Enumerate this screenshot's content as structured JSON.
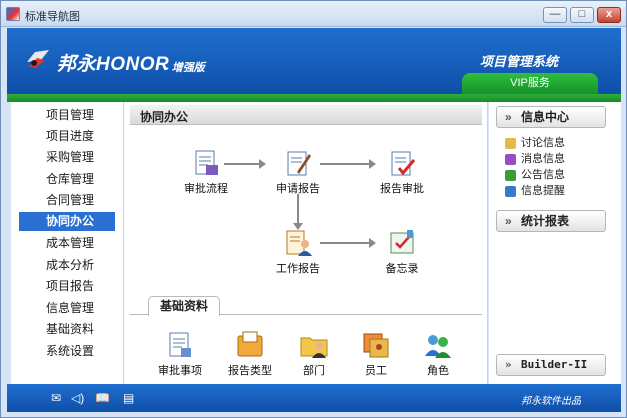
{
  "window": {
    "title": "标准导航图"
  },
  "header": {
    "brand": "邦永HONOR",
    "edition": "- 增强版",
    "system_title": "项目管理系统",
    "vip_tab": "VIP服务"
  },
  "nav": {
    "items": [
      {
        "label": "项目管理"
      },
      {
        "label": "项目进度"
      },
      {
        "label": "采购管理"
      },
      {
        "label": "仓库管理"
      },
      {
        "label": "合同管理"
      },
      {
        "label": "协同办公"
      },
      {
        "label": "成本管理"
      },
      {
        "label": "成本分析"
      },
      {
        "label": "项目报告"
      },
      {
        "label": "信息管理"
      },
      {
        "label": "基础资料"
      },
      {
        "label": "系统设置"
      }
    ],
    "active": "协同办公"
  },
  "center": {
    "title": "协同办公",
    "flow": {
      "approval_flow": "审批流程",
      "apply_report": "申请报告",
      "report_approve": "报告审批",
      "work_report": "工作报告",
      "memo": "备忘录"
    },
    "basic_tab": "基础资料",
    "basic_items": {
      "approval_items": "审批事项",
      "report_types": "报告类型",
      "department": "部门",
      "staff": "员工",
      "role": "角色"
    }
  },
  "right": {
    "info_center": "信息中心",
    "info_items": [
      {
        "label": "讨论信息",
        "color": "#e8b84a"
      },
      {
        "label": "消息信息",
        "color": "#9a4fc0"
      },
      {
        "label": "公告信息",
        "color": "#3a9b3a"
      },
      {
        "label": "信息提醒",
        "color": "#3a78c8"
      }
    ],
    "stats": "统计报表",
    "builder": "Builder-II"
  },
  "footer": {
    "company": "邦永软件出品"
  },
  "colors": {
    "accent": "#1f6fd0",
    "green": "#1f9f32",
    "active_nav": "#2a6fd1"
  }
}
